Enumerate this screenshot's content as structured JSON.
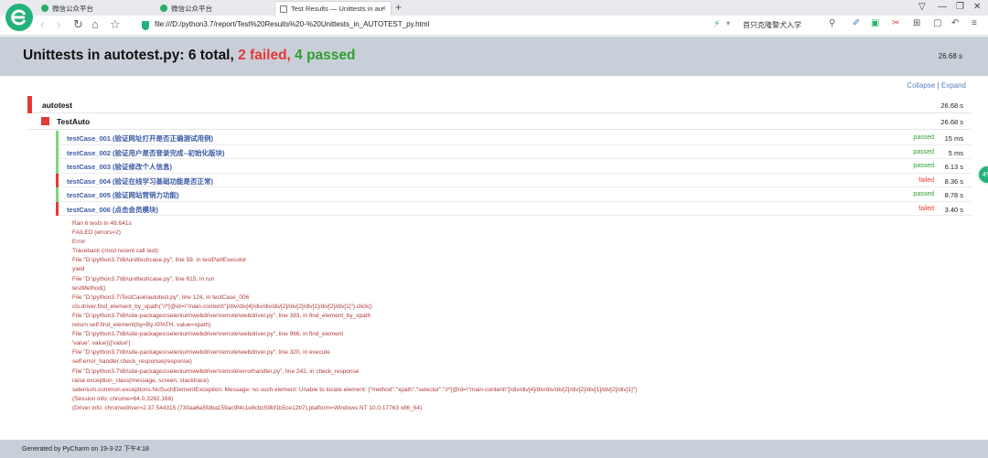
{
  "browser": {
    "tabs": [
      {
        "label": "微信公众平台",
        "active": false
      },
      {
        "label": "微信公众平台",
        "active": false
      },
      {
        "label": "Test Results — Unittests in au",
        "active": true
      }
    ],
    "tab_close": "×",
    "new_tab": "+",
    "window_controls": [
      "▽",
      "—",
      "❐",
      "✕"
    ],
    "nav_icons": [
      "‹",
      "›",
      "↻",
      "⌂",
      "☆"
    ],
    "url": "file:///D:/python3.7/report/Test%20Results%20-%20Unittests_in_AUTOTEST_py.html",
    "search_placeholder": "首只克隆警犬入学",
    "toolbar_icons": [
      "⚡",
      "▾",
      "⚲",
      "✐",
      "▣",
      "✂",
      "⊞",
      "▢",
      "↶",
      "≡"
    ],
    "colors": {
      "brand": "#23b37a"
    }
  },
  "report": {
    "title_prefix": "Unittests in autotest.py: 6 total,",
    "failed_text": "2 failed,",
    "passed_text": "4 passed",
    "total_time": "26.68 s",
    "collapse": "Collapse",
    "separator": "|",
    "expand": "Expand",
    "colors": {
      "failed": "#e53935",
      "passed": "#2ca02c",
      "header_bg": "#c9cfd9",
      "case_link": "#3b5aa6"
    }
  },
  "suite": {
    "name": "autotest",
    "time": "26.68 s"
  },
  "test_class": {
    "name": "TestAuto",
    "time": "26.68 s"
  },
  "cases": [
    {
      "name": "testCase_001 (验证网址打开是否正确测试用例)",
      "status": "passed",
      "time": "15 ms"
    },
    {
      "name": "testCase_002 (验证用户是否登录完成--初始化版块)",
      "status": "passed",
      "time": "5 ms"
    },
    {
      "name": "testCase_003 (验证修改个人信息)",
      "status": "passed",
      "time": "6.13 s"
    },
    {
      "name": "testCase_004 (验证在线学习基础功能是否正常)",
      "status": "failed",
      "time": "8.36 s"
    },
    {
      "name": "testCase_005 (验证网站营销力功能)",
      "status": "passed",
      "time": "8.78 s"
    },
    {
      "name": "testCase_006 (点击会员模块)",
      "status": "failed",
      "time": "3.40 s"
    }
  ],
  "traceback": [
    "Ran 6 tests in 48.641s",
    "FAILED (errors=2)",
    "Error",
    "Traceback (most recent call last):",
    "File \"D:\\python3.7\\lib\\unittest\\case.py\", line 59, in testPartExecutor",
    "yield",
    "File \"D:\\python3.7\\lib\\unittest\\case.py\", line 615, in run",
    "testMethod()",
    "File \"D:\\python3.7\\TestCase\\autotest.py\", line 124, in testCase_006",
    "cls.driver.find_element_by_xpath(\"//*[@id=\\\"main-content\\\"]/div/div[4]/div/div/div[2]/div[2]/div[1]/div[2]/div[1]\").click()",
    "File \"D:\\python3.7\\lib\\site-packages\\selenium\\webdriver\\remote\\webdriver.py\", line 393, in find_element_by_xpath",
    "return self.find_element(by=By.XPATH, value=xpath)",
    "File \"D:\\python3.7\\lib\\site-packages\\selenium\\webdriver\\remote\\webdriver.py\", line 966, in find_element",
    "'value': value})['value']",
    "File \"D:\\python3.7\\lib\\site-packages\\selenium\\webdriver\\remote\\webdriver.py\", line 320, in execute",
    "self.error_handler.check_response(response)",
    "File \"D:\\python3.7\\lib\\site-packages\\selenium\\webdriver\\remote\\errorhandler.py\", line 242, in check_response",
    "raise exception_class(message, screen, stacktrace)",
    "selenium.common.exceptions.NoSuchElementException: Message: no such element: Unable to locate element: {\"method\":\"xpath\",\"selector\":\"//*[@id=\\\"main-content\\\"]/div/div[4]/div/div/div[2]/div[2]/div[1]/div[2]/div[1]\"}",
    "(Session info: chrome=64.0.3282.168)",
    "(Driver info: chromedriver=2.37.544315 (730aa6a5fdba159ac9f4c1e8cbc59bf1b5ce12b7),platform=Windows NT 10.0.17763 x86_64)"
  ],
  "footer": {
    "text": "Generated by PyCharm on 19-3-22 下午4:18"
  },
  "side_widget": {
    "label": "4%"
  }
}
